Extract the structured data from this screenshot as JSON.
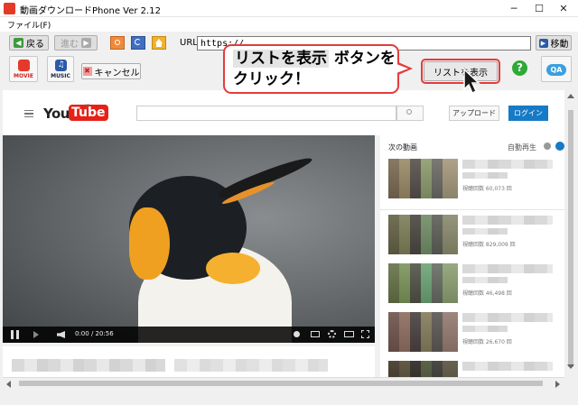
{
  "window": {
    "title": "動画ダウンロードPhone Ver 2.12",
    "minimize_glyph": "─",
    "maximize_glyph": "☐",
    "close_glyph": "✕"
  },
  "menu": {
    "file": "ファイル(F)"
  },
  "nav": {
    "back": "戻る",
    "forward": "進む",
    "url_label": "URL",
    "url_value": "https://",
    "go": "移動"
  },
  "toolbar": {
    "movie": "MOVIE",
    "music": "MUSIC",
    "cancel": "キャンセル",
    "show_list": "リストを表示",
    "qa": "QA"
  },
  "callout": {
    "highlight": "リストを表示",
    "line1_rest": "ボタンを",
    "line2": "クリック！"
  },
  "youtube": {
    "logo": "YouTube",
    "logo_region": "JP",
    "upload": "アップロード",
    "login": "ログイン",
    "up_next": "次の動画",
    "autoplay": "自動再生",
    "player_time": "0:00 / 20:56",
    "related": [
      {
        "views": "視聴回数 60,073 回"
      },
      {
        "views": "視聴回数 829,009 回"
      },
      {
        "views": "視聴回数 46,498 回"
      },
      {
        "views": "視聴回数 26,670 回"
      },
      {
        "views": ""
      }
    ]
  },
  "colors": {
    "youtube_red": "#e62117",
    "login_blue": "#167ac6",
    "callout_red": "#e33c3c",
    "movie_red": "#e53a2a",
    "music_blue": "#2b5aa8",
    "help_green": "#2eaa36"
  }
}
